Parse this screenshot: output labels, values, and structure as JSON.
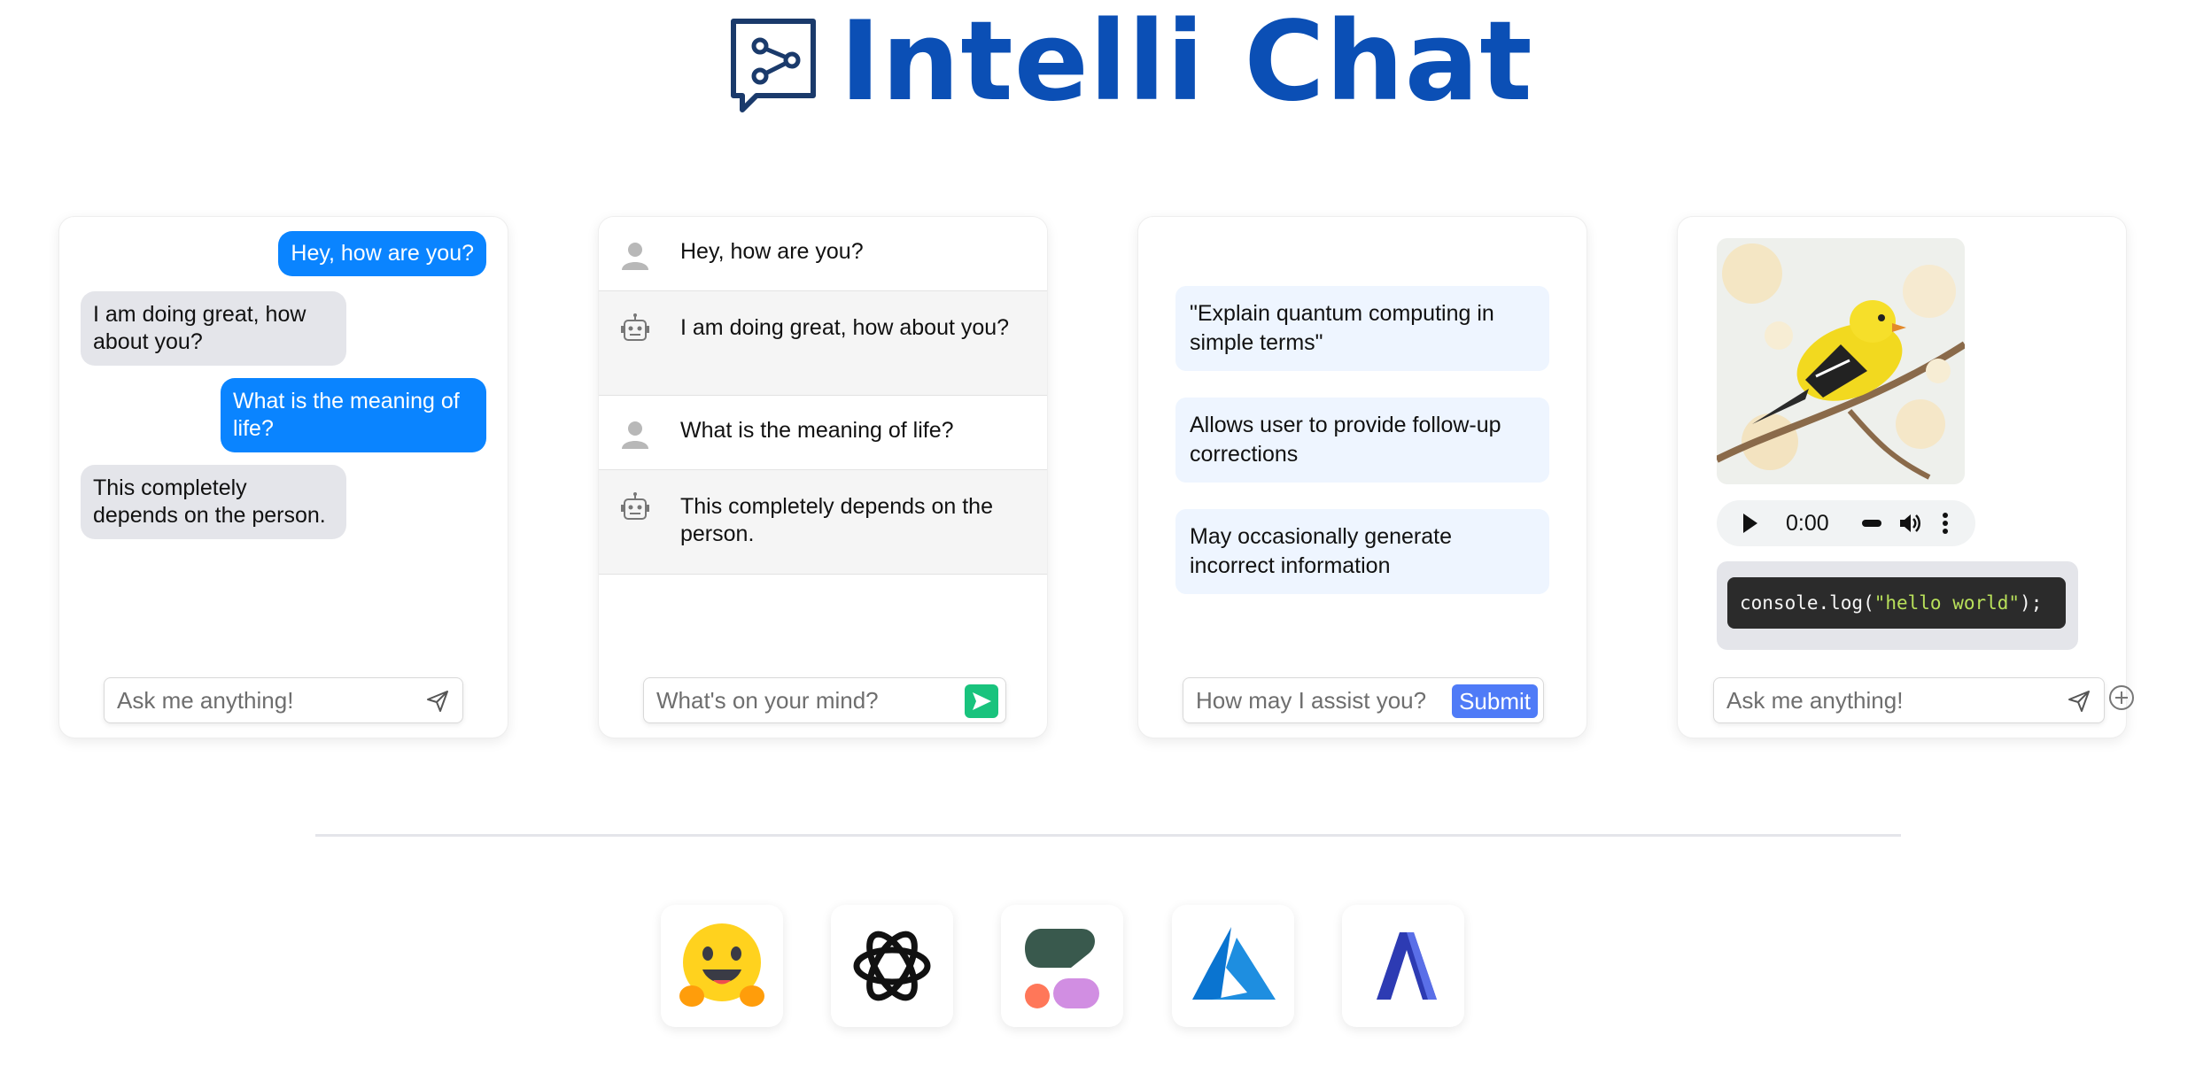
{
  "header": {
    "title": "Intelli Chat",
    "logo_icon": "chat-share-icon",
    "title_color": "#0b4fb5"
  },
  "demos": [
    {
      "style": "bubble-chat",
      "messages": [
        {
          "role": "user",
          "text": "Hey, how are you?"
        },
        {
          "role": "bot",
          "text": "I am doing great, how about you?"
        },
        {
          "role": "user",
          "text": "What is the meaning of life?"
        },
        {
          "role": "bot",
          "text": "This completely depends on the person."
        }
      ],
      "input": {
        "placeholder": "Ask me anything!",
        "send_icon": "send-icon"
      }
    },
    {
      "style": "list-chat",
      "messages": [
        {
          "role": "user",
          "avatar_icon": "user-avatar-icon",
          "text": "Hey, how are you?"
        },
        {
          "role": "bot",
          "avatar_icon": "robot-avatar-icon",
          "text": "I am doing great, how about you?"
        },
        {
          "role": "user",
          "avatar_icon": "user-avatar-icon",
          "text": "What is the meaning of life?"
        },
        {
          "role": "bot",
          "avatar_icon": "robot-avatar-icon",
          "text": "This completely depends on the person."
        }
      ],
      "input": {
        "placeholder": "What's on your mind?",
        "send_icon": "send-icon",
        "accent": "#19c37d"
      }
    },
    {
      "style": "suggestions",
      "suggestions": [
        "\"Explain quantum computing in simple terms\"",
        "Allows user to provide follow-up corrections",
        "May occasionally generate incorrect information"
      ],
      "input": {
        "placeholder": "How may I assist you?",
        "submit_label": "Submit",
        "accent": "#4f7bf7"
      }
    },
    {
      "style": "media-chat",
      "image_icon": "goldfinch-bird-image",
      "audio": {
        "time": "0:00"
      },
      "code": {
        "prefix": "console.log(",
        "string": "\"hello world\"",
        "suffix": ");"
      },
      "input": {
        "placeholder": "Ask me anything!",
        "send_icon": "send-icon"
      },
      "attach_icon": "plus-circle-icon"
    }
  ],
  "providers": [
    {
      "name_icon": "hugging-face-logo"
    },
    {
      "name_icon": "openai-logo"
    },
    {
      "name_icon": "cohere-logo"
    },
    {
      "name_icon": "azure-logo"
    },
    {
      "name_icon": "anyscale-logo"
    }
  ]
}
